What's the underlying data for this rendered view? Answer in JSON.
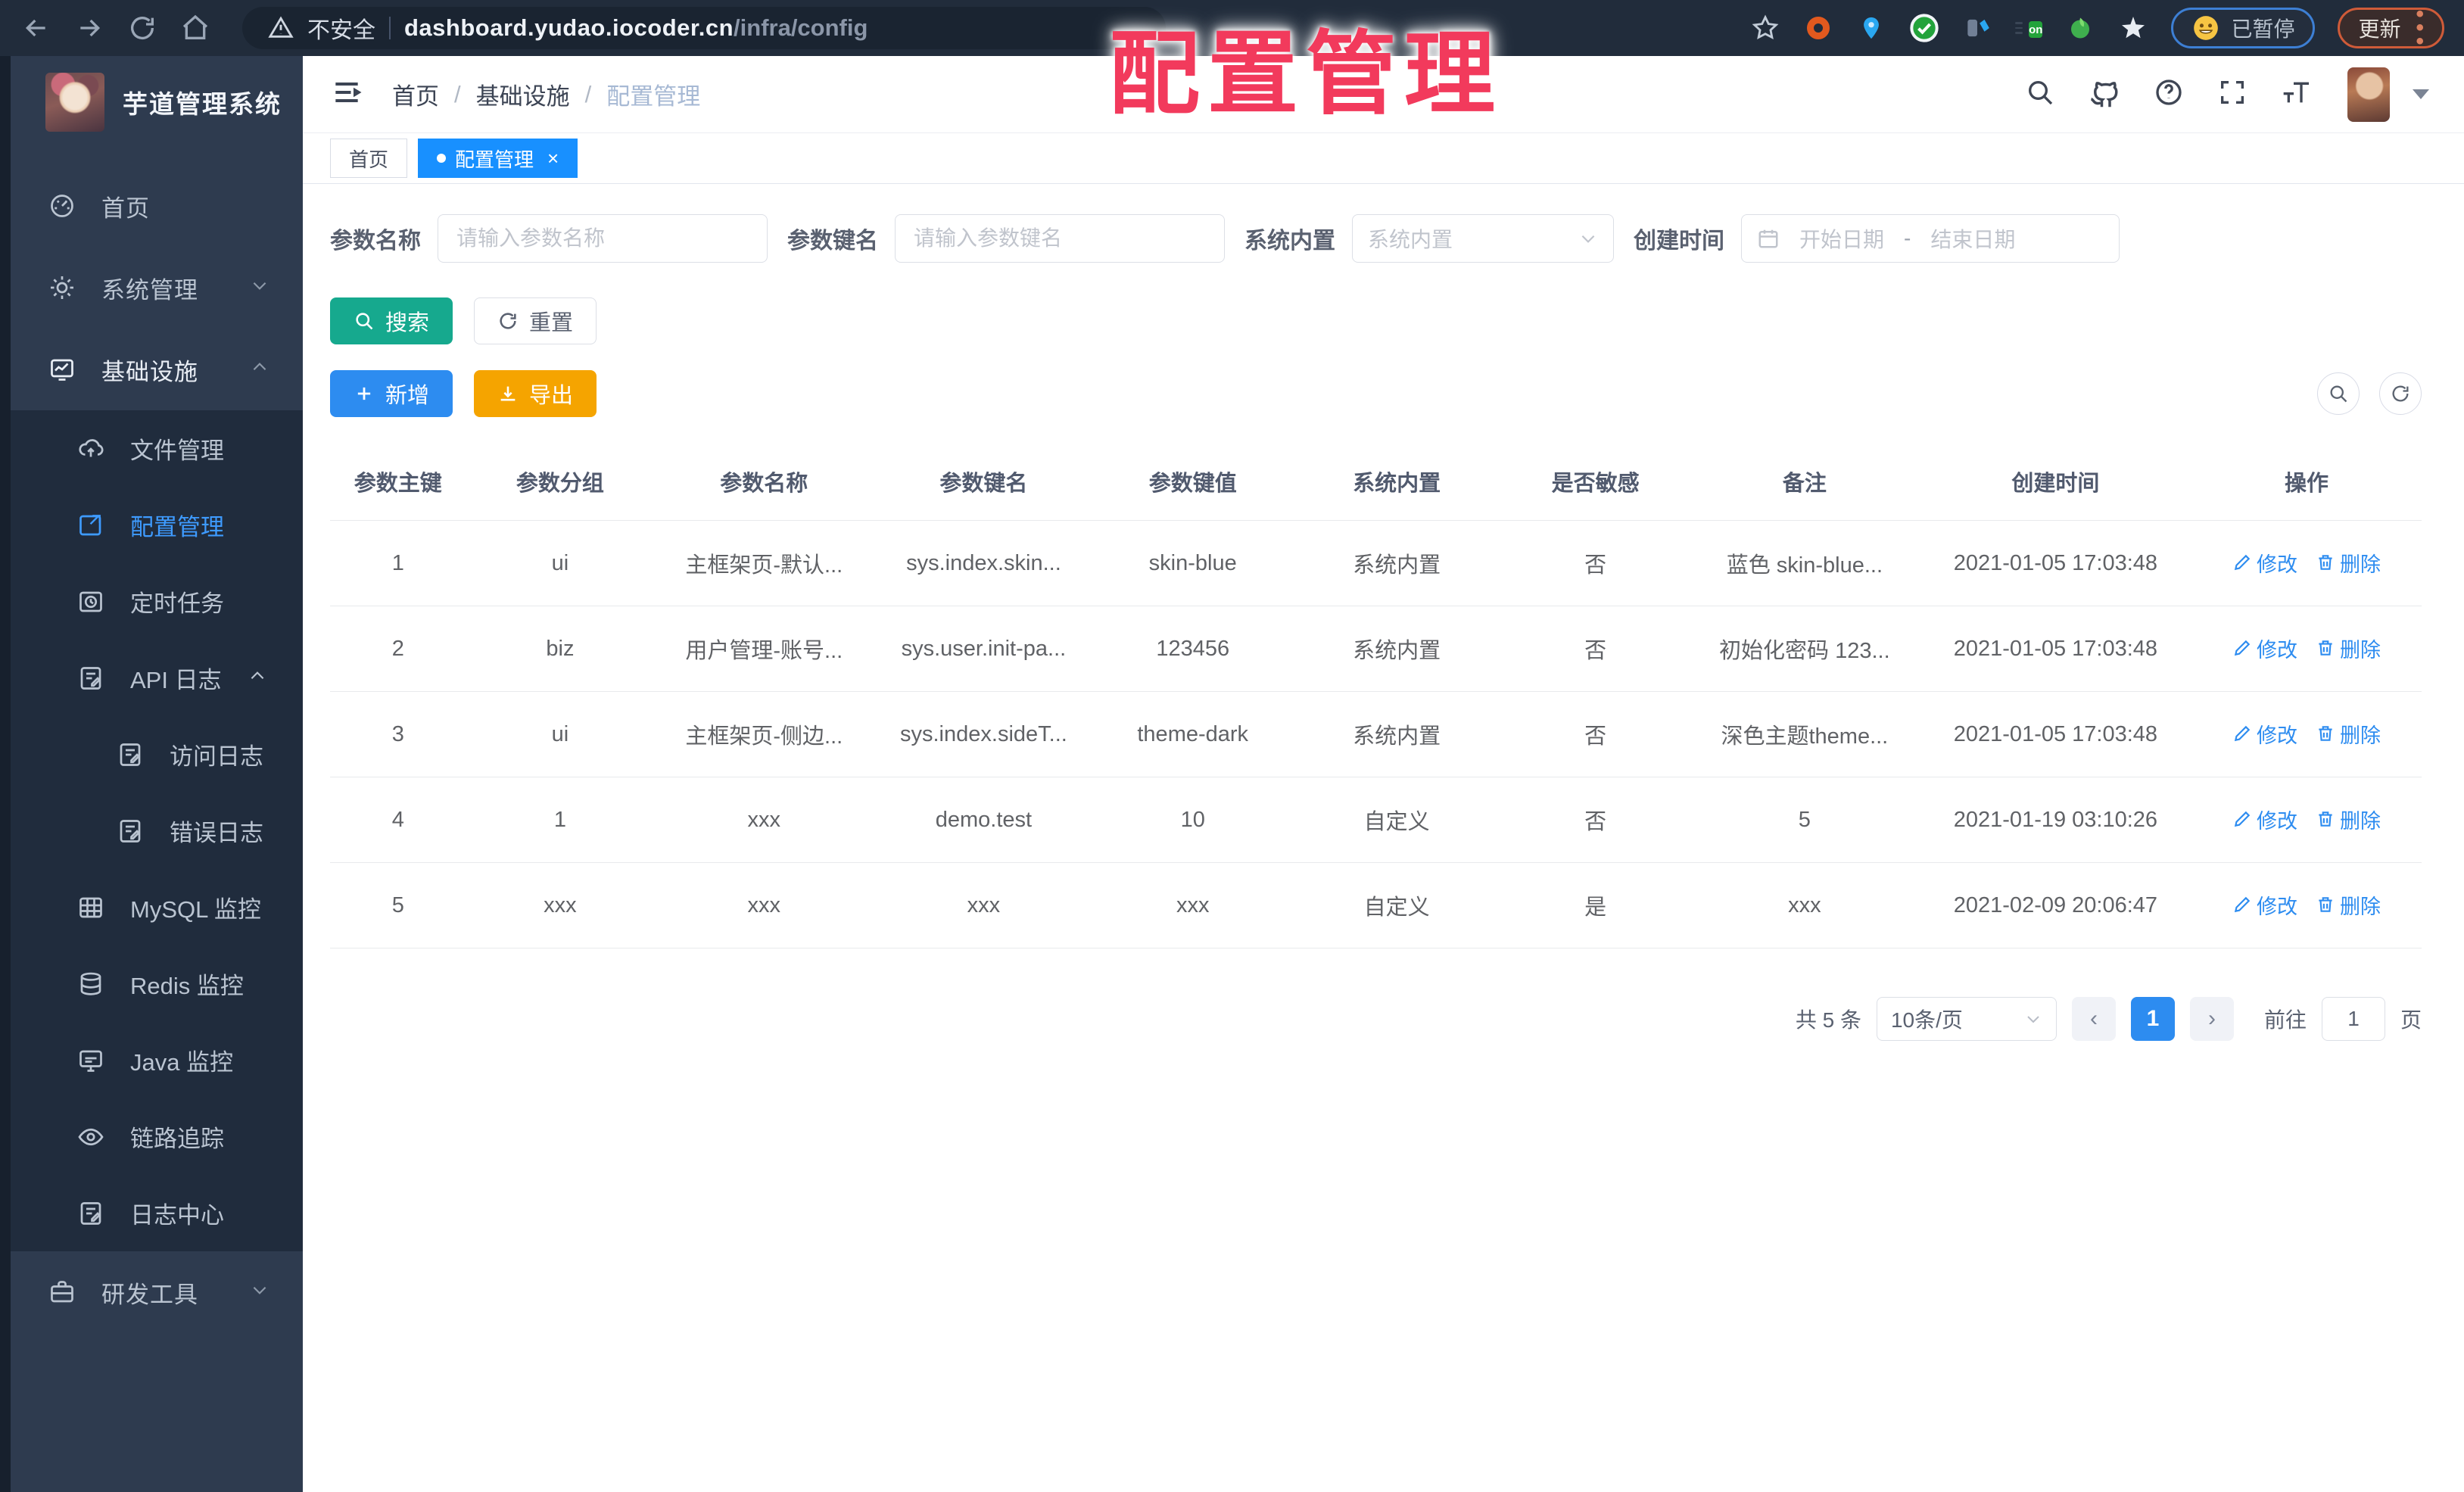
{
  "browser": {
    "security_label": "不安全",
    "url_host": "dashboard.yudao.iocoder.cn",
    "url_path": "/infra/config",
    "paused_badge": "已暂停",
    "update_label": "更新"
  },
  "overlay_title": "配置管理",
  "colors": {
    "primary": "#2d8cf0",
    "tab_active": "#1890ff",
    "search_btn": "#16a98e",
    "export_btn": "#f5a400",
    "overlay_red": "#f23a5c",
    "sidebar_bg": "#2e3b4f",
    "submenu_bg": "#202c3d"
  },
  "sidebar": {
    "app_title": "芋道管理系统",
    "items": [
      {
        "label": "首页"
      },
      {
        "label": "系统管理"
      },
      {
        "label": "基础设施"
      },
      {
        "label": "文件管理"
      },
      {
        "label": "配置管理"
      },
      {
        "label": "定时任务"
      },
      {
        "label": "API 日志"
      },
      {
        "label": "访问日志"
      },
      {
        "label": "错误日志"
      },
      {
        "label": "MySQL 监控"
      },
      {
        "label": "Redis 监控"
      },
      {
        "label": "Java 监控"
      },
      {
        "label": "链路追踪"
      },
      {
        "label": "日志中心"
      },
      {
        "label": "研发工具"
      }
    ]
  },
  "header": {
    "breadcrumb": [
      "首页",
      "基础设施",
      "配置管理"
    ],
    "breadcrumb_sep": "/"
  },
  "tabs": [
    {
      "label": "首页"
    },
    {
      "label": "配置管理",
      "close": "×"
    }
  ],
  "filters": {
    "name_label": "参数名称",
    "name_placeholder": "请输入参数名称",
    "key_label": "参数键名",
    "key_placeholder": "请输入参数键名",
    "type_label": "系统内置",
    "type_placeholder": "系统内置",
    "date_label": "创建时间",
    "date_start": "开始日期",
    "date_sep": "-",
    "date_end": "结束日期"
  },
  "actions": {
    "search": "搜索",
    "reset": "重置",
    "create": "新增",
    "export": "导出"
  },
  "table": {
    "headers": [
      "参数主键",
      "参数分组",
      "参数名称",
      "参数键名",
      "参数键值",
      "系统内置",
      "是否敏感",
      "备注",
      "创建时间",
      "操作"
    ],
    "rows": [
      [
        "1",
        "ui",
        "主框架页-默认...",
        "sys.index.skin...",
        "skin-blue",
        "系统内置",
        "否",
        "蓝色 skin-blue...",
        "2021-01-05 17:03:48"
      ],
      [
        "2",
        "biz",
        "用户管理-账号...",
        "sys.user.init-pa...",
        "123456",
        "系统内置",
        "否",
        "初始化密码 123...",
        "2021-01-05 17:03:48"
      ],
      [
        "3",
        "ui",
        "主框架页-侧边...",
        "sys.index.sideT...",
        "theme-dark",
        "系统内置",
        "否",
        "深色主题theme...",
        "2021-01-05 17:03:48"
      ],
      [
        "4",
        "1",
        "xxx",
        "demo.test",
        "10",
        "自定义",
        "否",
        "5",
        "2021-01-19 03:10:26"
      ],
      [
        "5",
        "xxx",
        "xxx",
        "xxx",
        "xxx",
        "自定义",
        "是",
        "xxx",
        "2021-02-09 20:06:47"
      ]
    ],
    "edit_label": "修改",
    "delete_label": "删除"
  },
  "pagination": {
    "total": "共 5 条",
    "page_size": "10条/页",
    "prev": "‹",
    "next": "›",
    "current": "1",
    "goto_label": "前往",
    "goto_value": "1",
    "page_suffix": "页"
  }
}
